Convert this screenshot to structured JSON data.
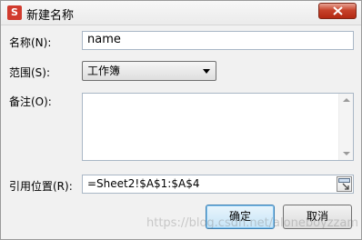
{
  "window": {
    "title": "新建名称",
    "app_icon_glyph": "S"
  },
  "form": {
    "name_label": "名称(N):",
    "name_value": "name",
    "scope_label": "范围(S):",
    "scope_value": "工作簿",
    "comment_label": "备注(O):",
    "comment_value": "",
    "refers_to_label": "引用位置(R):",
    "refers_to_value": "=Sheet2!$A$1:$A$4"
  },
  "buttons": {
    "ok_label": "确定",
    "cancel_label": "取消"
  },
  "watermark": "https://blog.csdn.net/aloneboyzzam",
  "colors": {
    "close_button": "#c7432b",
    "app_icon": "#d13b2e",
    "default_button_border": "#3c7fb1"
  }
}
